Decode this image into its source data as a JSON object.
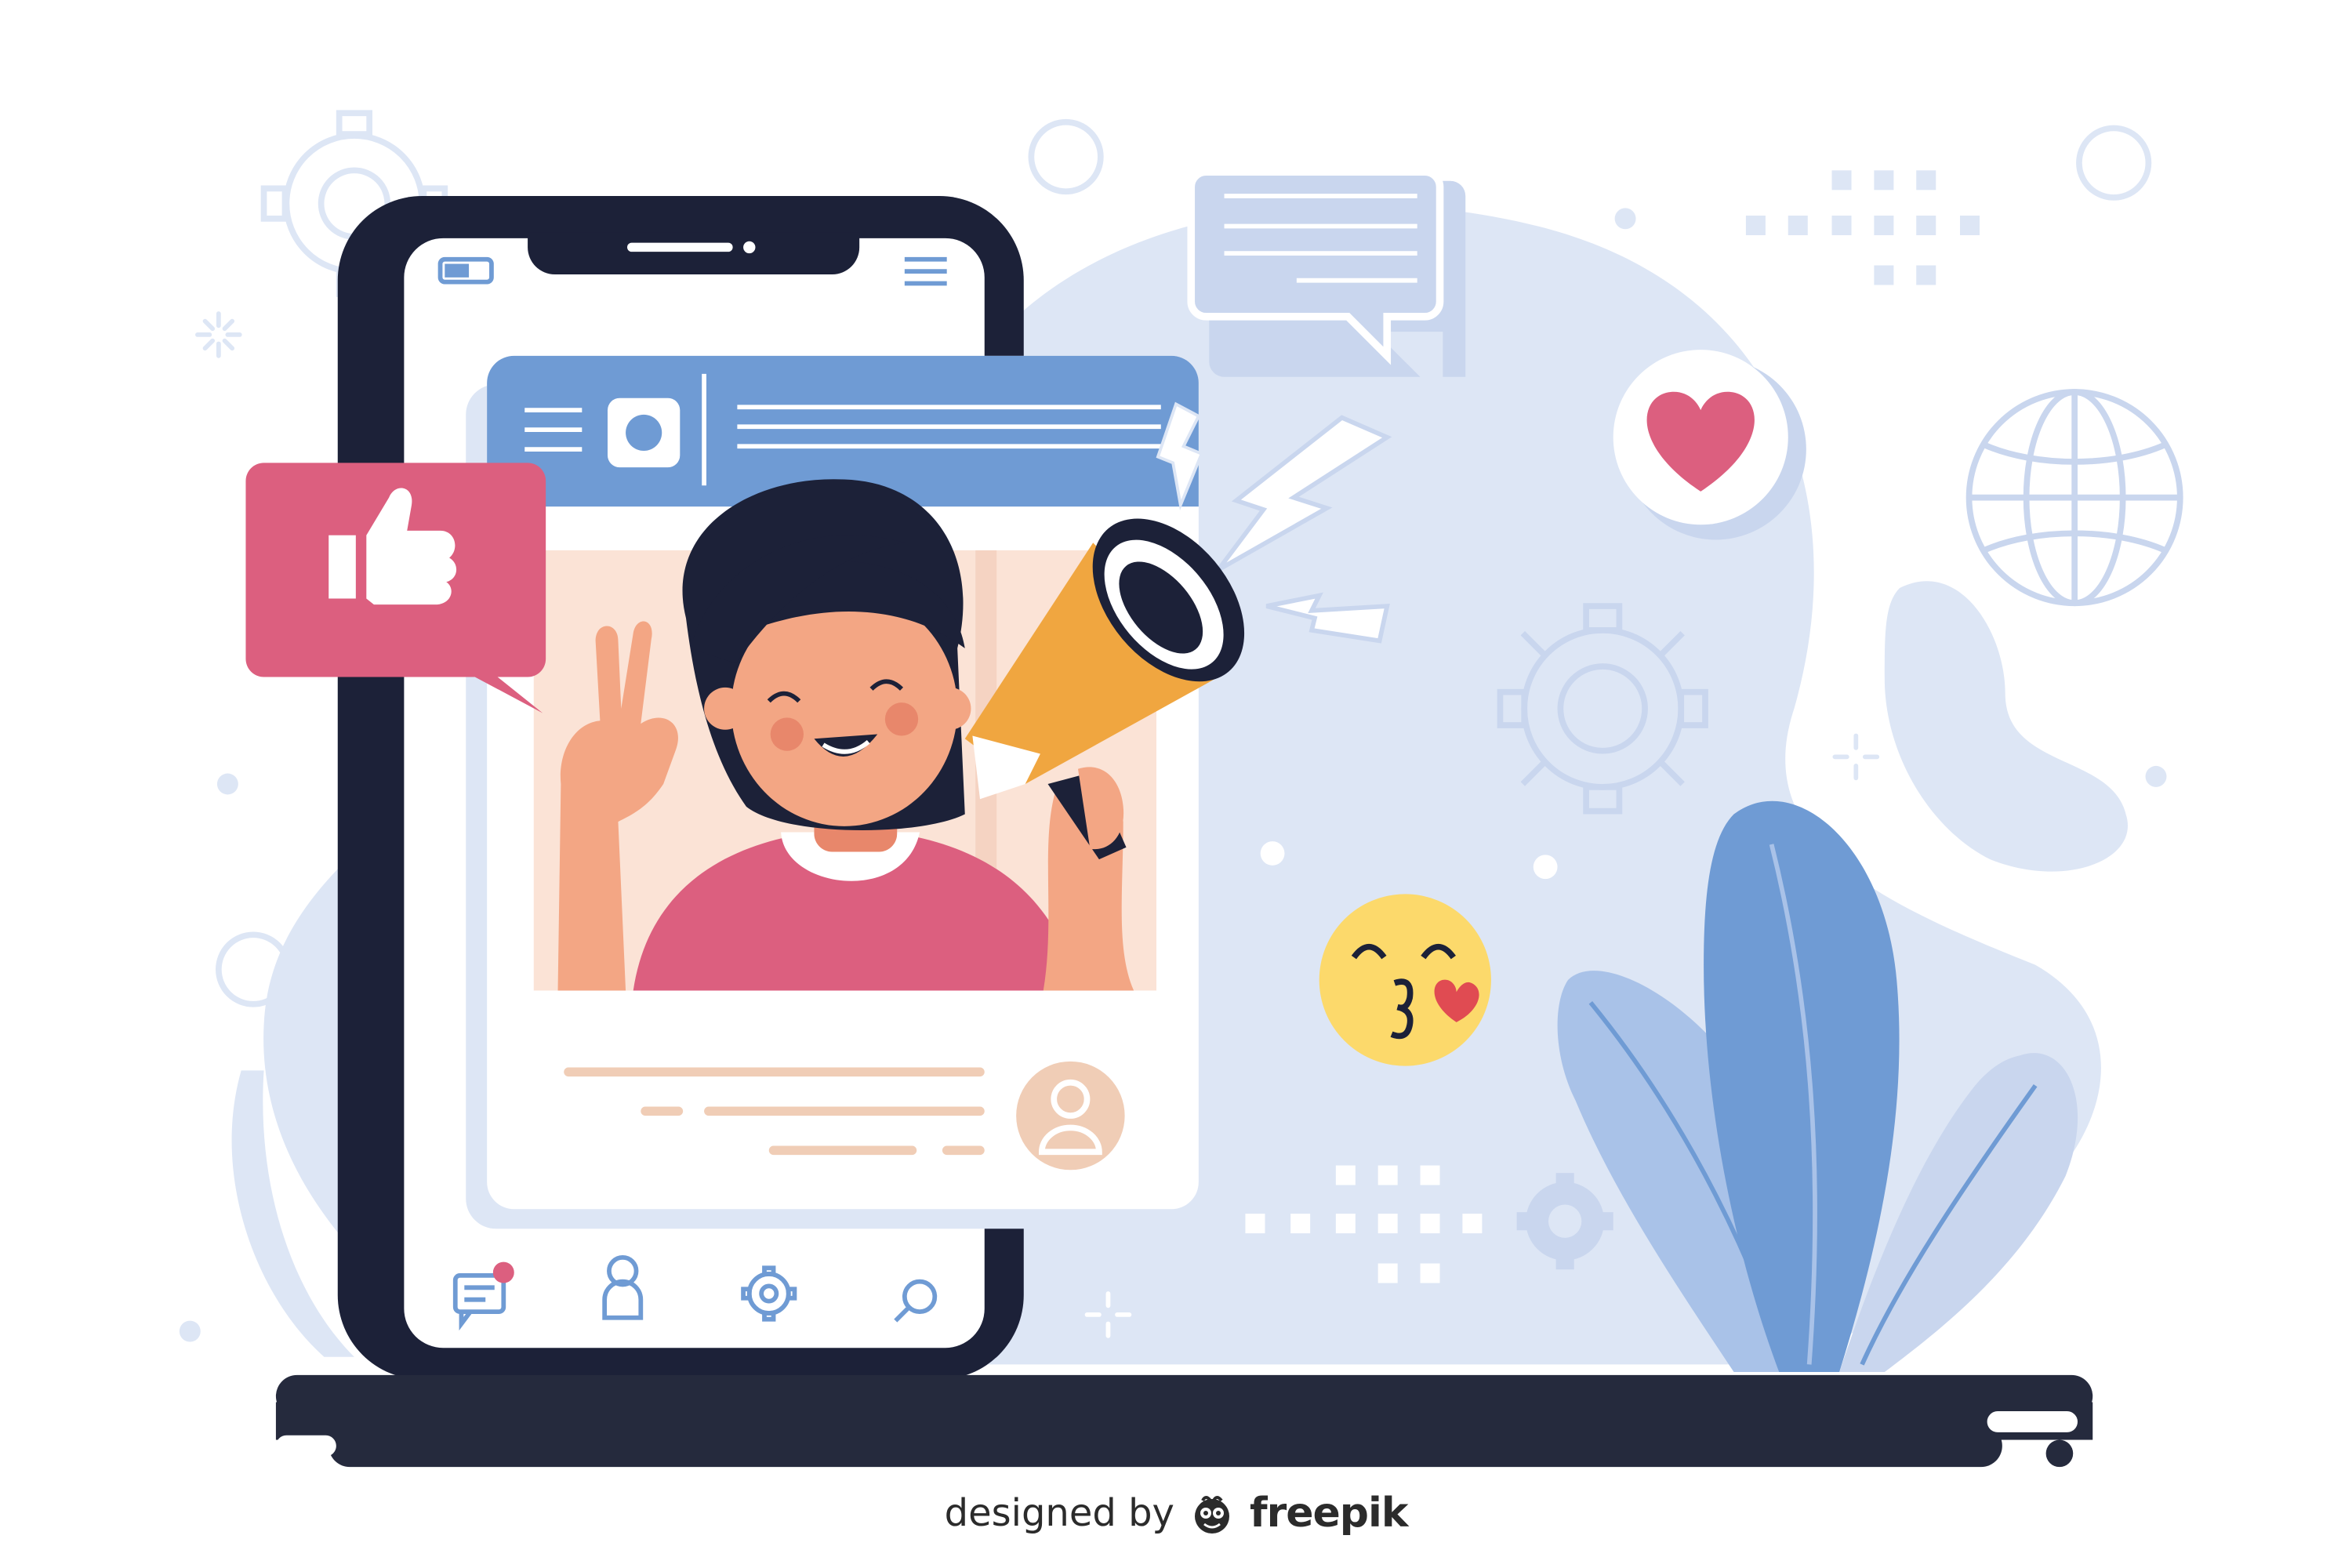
{
  "credit": {
    "prefix": "designed by",
    "brand": "freepik"
  },
  "icons": [
    "gear-icon",
    "globe-icon",
    "heart-icon",
    "thumbs-up-icon",
    "megaphone-icon",
    "chat-bubble-icon",
    "kiss-emoji-icon",
    "user-avatar-icon",
    "messages-icon",
    "profile-icon",
    "settings-icon",
    "search-icon",
    "leaf-plant",
    "camera-icon",
    "lightning-icon",
    "sparkle-icon"
  ],
  "colors": {
    "blob": "#dde6f5",
    "line": "#c9d6ee",
    "phone": "#1c2138",
    "screen": "#ffffff",
    "post_bar": "#6f9bd4",
    "like_badge": "#dc5f7f",
    "photo_bg": "#fbe3d6",
    "skin": "#f3a684",
    "hair": "#1c2138",
    "shirt": "#dc5f7f",
    "megaphone": "#f0a640",
    "emoji": "#fcd96b",
    "leaf_dark": "#6f9bd4",
    "leaf_light": "#a9c2e8",
    "ground": "#252a3d",
    "text_lines": "#f0cdb6"
  }
}
